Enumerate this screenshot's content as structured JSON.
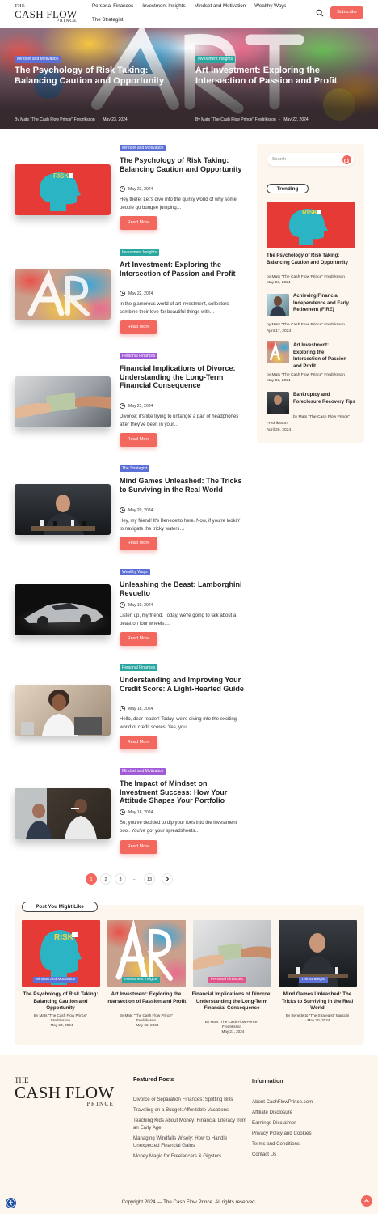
{
  "header": {
    "logo": {
      "the": "THE",
      "main": "CASH FLOW",
      "prince": "PRINCE"
    },
    "nav": [
      "Personal Finances",
      "Investment Insights",
      "Mindset and Motivation",
      "Wealthy Ways",
      "The Strategist"
    ],
    "subscribe_label": "Subscribe",
    "search_icon": "search-icon"
  },
  "hero": [
    {
      "category": "Mindset and Motivation",
      "category_color": "#5b6fd6",
      "title": "The Psychology of Risk Taking: Balancing Caution and Opportunity",
      "author": "By Mats \"The Cash Flow Prince\" Fredriksson",
      "date": "May 23, 2024"
    },
    {
      "category": "Investment Insights",
      "category_color": "#2aa6a0",
      "title": "Art Investment: Exploring the Intersection of Passion and Profit",
      "author": "By Mats \"The Cash Flow Prince\" Fredriksson",
      "date": "May 22, 2024"
    }
  ],
  "posts": [
    {
      "category": "Mindset and Motivation",
      "category_color": "#5b6fd6",
      "title": "The Psychology of Risk Taking: Balancing Caution and Opportunity",
      "date": "May 23, 2024",
      "excerpt": "Hey there! Let's dive into the quirky world of why some people go bungee jumping…",
      "read_more": "Read More"
    },
    {
      "category": "Investment Insights",
      "category_color": "#2aa6a0",
      "title": "Art Investment: Exploring the Intersection of Passion and Profit",
      "date": "May 22, 2024",
      "excerpt": "In the glamorous world of art investment, collectors combine their love for beautiful things with…",
      "read_more": "Read More"
    },
    {
      "category": "Personal Finances",
      "category_color": "#a05bd6",
      "title": "Financial Implications of Divorce: Understanding the Long-Term Financial Consequence",
      "date": "May 21, 2024",
      "excerpt": "Divorce: it's like trying to untangle a pair of headphones after they've been in your…",
      "read_more": "Read More"
    },
    {
      "category": "The Strategist",
      "category_color": "#5b6fd6",
      "title": "Mind Games Unleashed: The Tricks to Surviving in the Real World",
      "date": "May 20, 2024",
      "excerpt": "Hey, my friend! It's Benedetto here. Now, if you're lookin' to navigate the tricky waters…",
      "read_more": "Read More"
    },
    {
      "category": "Wealthy Ways",
      "category_color": "#5b6fd6",
      "title": "Unleashing the Beast: Lamborghini Revuelto",
      "date": "May 19, 2024",
      "excerpt": "Listen up, my friend. Today, we're going to talk about a beast on four wheels:…",
      "read_more": "Read More"
    },
    {
      "category": "Personal Finances",
      "category_color": "#2aa6a0",
      "title": "Understanding and Improving Your Credit Score: A Light-Hearted Guide",
      "date": "May 18, 2024",
      "excerpt": "Hello, dear reader! Today, we're diving into the exciting world of credit scores. Yes, you…",
      "read_more": "Read More"
    },
    {
      "category": "Mindset and Motivation",
      "category_color": "#a05bd6",
      "title": "The Impact of Mindset on Investment Success: How Your Attitude Shapes Your Portfolio",
      "date": "May 16, 2024",
      "excerpt": "So, you've decided to dip your toes into the investment pool. You've got your spreadsheets…",
      "read_more": "Read More"
    }
  ],
  "pagination": {
    "pages": [
      "1",
      "2",
      "3",
      "…",
      "13"
    ],
    "current": "1",
    "next_icon": "chevron-right-icon"
  },
  "sidebar": {
    "search_placeholder": "Search",
    "trending_label": "Trending",
    "featured": {
      "title": "The Psychology of Risk Taking: Balancing Caution and Opportunity",
      "author": "by Mats \"The Cash Flow Prince\" Fredriksson",
      "date": "May 23, 2024"
    },
    "items": [
      {
        "title": "Achieving Financial Independence and Early Retirement (FIRE)",
        "author": "by Mats \"The Cash Flow Prince\" Fredriksson",
        "date": "April 17, 2024"
      },
      {
        "title": "Art Investment: Exploring the Intersection of Passion and Profit",
        "author": "by Mats \"The Cash Flow Prince\" Fredriksson",
        "date": "May 22, 2024"
      },
      {
        "title": "Bankruptcy and Foreclosure Recovery Tips",
        "author_line1": "by Mats \"The Cash Flow Prince\"",
        "author_line2": "Fredriksson",
        "date": "April 26, 2024"
      }
    ]
  },
  "related": {
    "label": "Post You Might Like",
    "posts": [
      {
        "category": "Mindset and Motivation",
        "category_color": "#5b6fd6",
        "title": "The Psychology of Risk Taking: Balancing Caution and Opportunity",
        "author1": "By Mats \"The Cash Flow Prince\"",
        "author2": "Fredriksson",
        "date": "· May 23, 2024"
      },
      {
        "category": "Investment Insights",
        "category_color": "#2aa6a0",
        "title": "Art Investment: Exploring the Intersection of Passion and Profit",
        "author1": "By Mats \"The Cash Flow Prince\"",
        "author2": "Fredriksson",
        "date": "· May 22, 2024"
      },
      {
        "category": "Personal Finances",
        "category_color": "#e0558a",
        "title": "Financial Implications of Divorce: Understanding the Long-Term Financial Consequence",
        "author1": "By Mats \"The Cash Flow Prince\"",
        "author2": "Fredriksson",
        "date": "· May 21, 2024"
      },
      {
        "category": "The Strategist",
        "category_color": "#5b6fd6",
        "title": "Mind Games Unleashed: The Tricks to Surviving in the Real World",
        "author1": "By Benedetto \"The Strategist\" Marconi",
        "author2": "",
        "date": "· May 20, 2024"
      }
    ]
  },
  "footer": {
    "featured_heading": "Featured Posts",
    "featured_links": [
      "Divorce or Separation Finances: Splitting Bills",
      "Traveling on a Budget: Affordable Vacations",
      "Teaching Kids About Money: Financial Literacy from an Early Age",
      "Managing Windfalls Wisely: How to Handle Unexpected Financial Gains",
      "Money Magic for Freelancers & Gigsters"
    ],
    "info_heading": "Information",
    "info_links": [
      "About CashFlowPrince.com",
      "Affiliate Disclosure",
      "Earnings Disclaimer",
      "Privacy Policy and Cookies",
      "Terms and Conditions",
      "Contact Us"
    ],
    "copyright": "Copyright 2024 — The Cash Flow Prince. All rights reserved."
  }
}
